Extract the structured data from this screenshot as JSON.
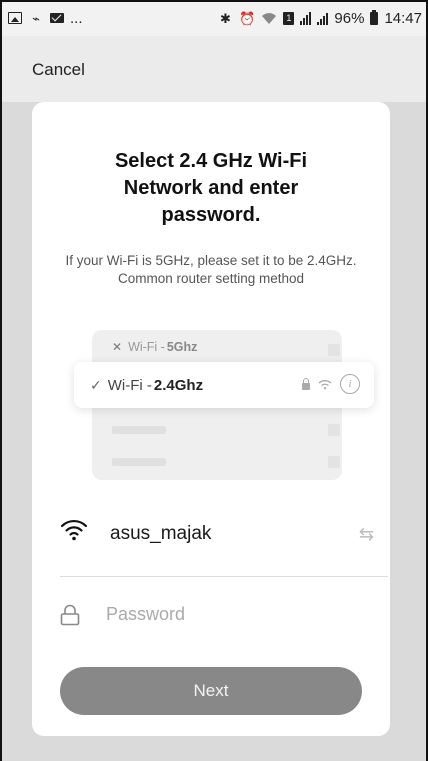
{
  "status_bar": {
    "left_dots": "...",
    "battery_pct": "96%",
    "time": "14:47",
    "sim": "1"
  },
  "top_bar": {
    "cancel_label": "Cancel"
  },
  "card": {
    "title": "Select 2.4 GHz Wi-Fi Network and enter password.",
    "subtitle": "If your Wi-Fi is 5GHz, please set it to be 2.4GHz. Common router setting method",
    "illustration": {
      "row_5g_prefix": "Wi-Fi - ",
      "row_5g_band": "5Ghz",
      "row_24_prefix": "Wi-Fi - ",
      "row_24_band": "2.4Ghz"
    },
    "network": {
      "ssid": "asus_majak"
    },
    "password": {
      "placeholder": "Password",
      "value": ""
    },
    "next_label": "Next"
  },
  "colors": {
    "card_bg": "#ffffff",
    "page_bg": "#ebebeb",
    "button_bg": "#888888",
    "muted_text": "#555555"
  }
}
